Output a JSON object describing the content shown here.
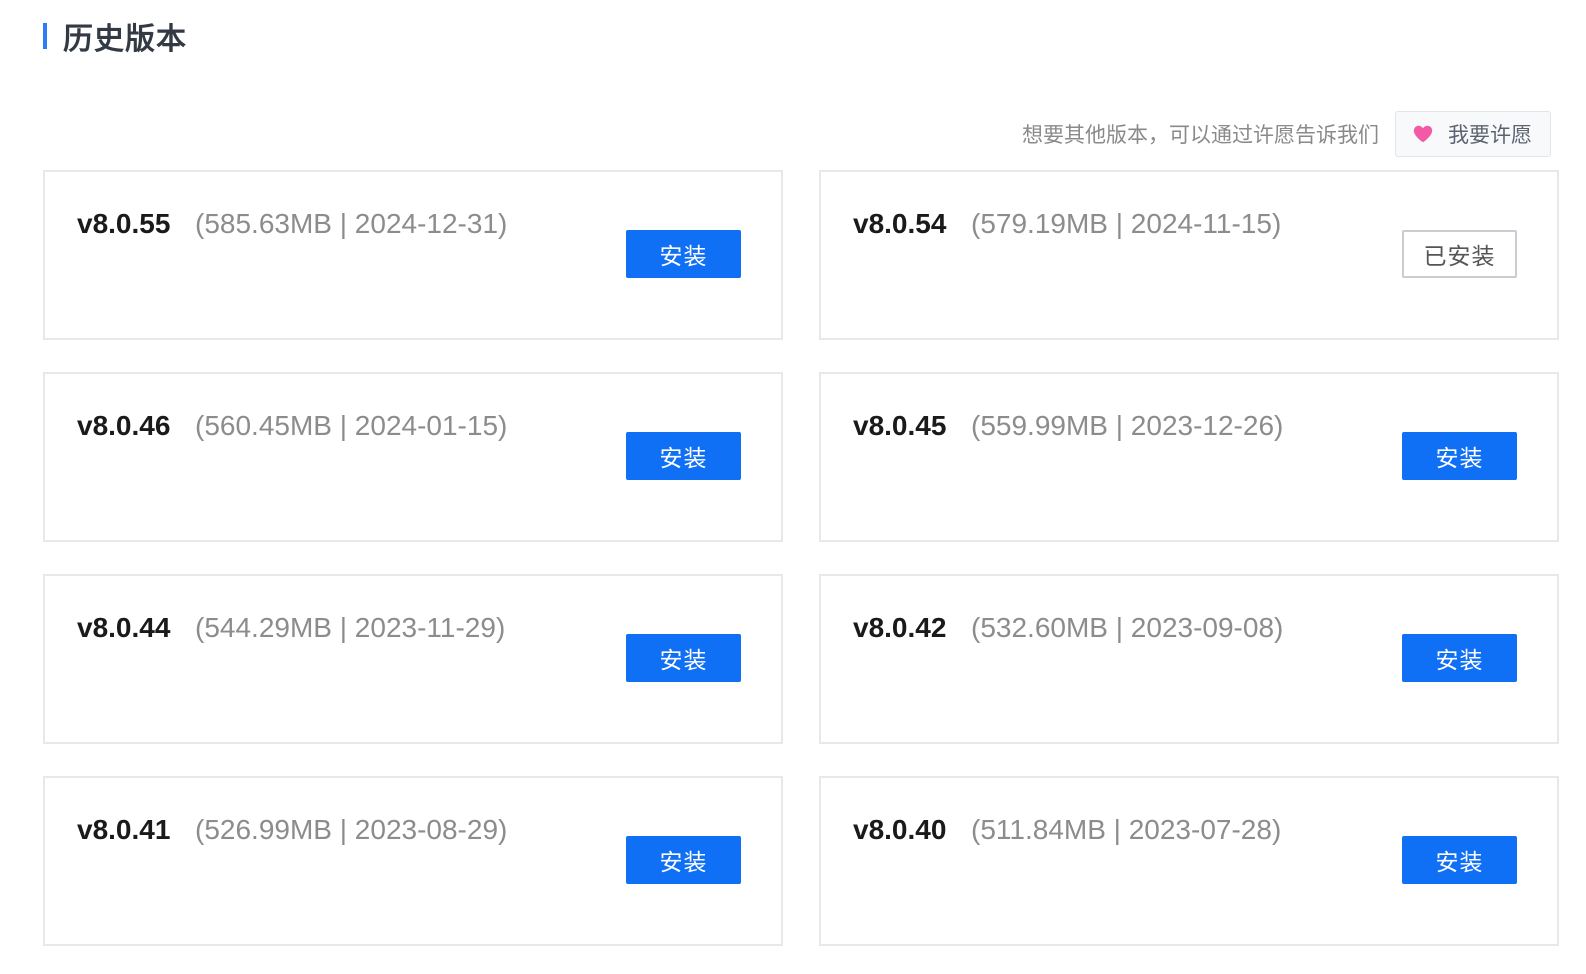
{
  "section": {
    "title": "历史版本"
  },
  "wish": {
    "prompt": "想要其他版本，可以通过许愿告诉我们",
    "button_label": "我要许愿"
  },
  "colors": {
    "accent": "#0f6ff5",
    "heart": "#f25aa5"
  },
  "versions": [
    {
      "version": "v8.0.55",
      "meta": "(585.63MB | 2024-12-31)",
      "action": "安装",
      "state": "install"
    },
    {
      "version": "v8.0.54",
      "meta": "(579.19MB | 2024-11-15)",
      "action": "已安装",
      "state": "installed"
    },
    {
      "version": "v8.0.46",
      "meta": "(560.45MB | 2024-01-15)",
      "action": "安装",
      "state": "install"
    },
    {
      "version": "v8.0.45",
      "meta": "(559.99MB | 2023-12-26)",
      "action": "安装",
      "state": "install"
    },
    {
      "version": "v8.0.44",
      "meta": "(544.29MB | 2023-11-29)",
      "action": "安装",
      "state": "install"
    },
    {
      "version": "v8.0.42",
      "meta": "(532.60MB | 2023-09-08)",
      "action": "安装",
      "state": "install"
    },
    {
      "version": "v8.0.41",
      "meta": "(526.99MB | 2023-08-29)",
      "action": "安装",
      "state": "install"
    },
    {
      "version": "v8.0.40",
      "meta": "(511.84MB | 2023-07-28)",
      "action": "安装",
      "state": "install"
    }
  ]
}
